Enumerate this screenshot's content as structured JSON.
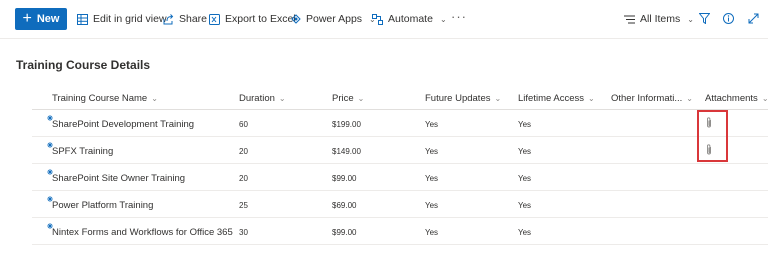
{
  "toolbar": {
    "new_label": "New",
    "edit_grid_label": "Edit in grid view",
    "share_label": "Share",
    "export_label": "Export to Excel",
    "power_apps_label": "Power Apps",
    "automate_label": "Automate",
    "more_label": "···",
    "view_label": "All Items"
  },
  "page": {
    "title": "Training Course Details"
  },
  "table": {
    "columns": [
      "Training Course Name",
      "Duration",
      "Price",
      "Future Updates",
      "Lifetime Access",
      "Other Informati...",
      "Attachments"
    ],
    "rows": [
      {
        "name": "SharePoint Development Training",
        "duration": "60",
        "price": "$199.00",
        "future_updates": "Yes",
        "lifetime_access": "Yes",
        "other_info": "",
        "has_attachment": true
      },
      {
        "name": "SPFX Training",
        "duration": "20",
        "price": "$149.00",
        "future_updates": "Yes",
        "lifetime_access": "Yes",
        "other_info": "",
        "has_attachment": true
      },
      {
        "name": "SharePoint Site Owner Training",
        "duration": "20",
        "price": "$99.00",
        "future_updates": "Yes",
        "lifetime_access": "Yes",
        "other_info": "",
        "has_attachment": false
      },
      {
        "name": "Power Platform Training",
        "duration": "25",
        "price": "$69.00",
        "future_updates": "Yes",
        "lifetime_access": "Yes",
        "other_info": "",
        "has_attachment": false
      },
      {
        "name": "Nintex Forms and Workflows for Office 365",
        "duration": "30",
        "price": "$99.00",
        "future_updates": "Yes",
        "lifetime_access": "Yes",
        "other_info": "",
        "has_attachment": false
      }
    ]
  },
  "icons": {
    "grid": "grid-icon",
    "share": "share-icon",
    "excel": "excel-icon",
    "power_apps": "power-apps-icon",
    "automate": "automate-icon",
    "view": "view-lines-icon",
    "filter": "filter-icon",
    "info": "info-icon",
    "expand": "expand-icon",
    "attachment": "paperclip-icon",
    "new_item": "new-item-sparkle-icon"
  },
  "colors": {
    "accent": "#0f6cbd",
    "highlight_box": "#d9373a"
  }
}
